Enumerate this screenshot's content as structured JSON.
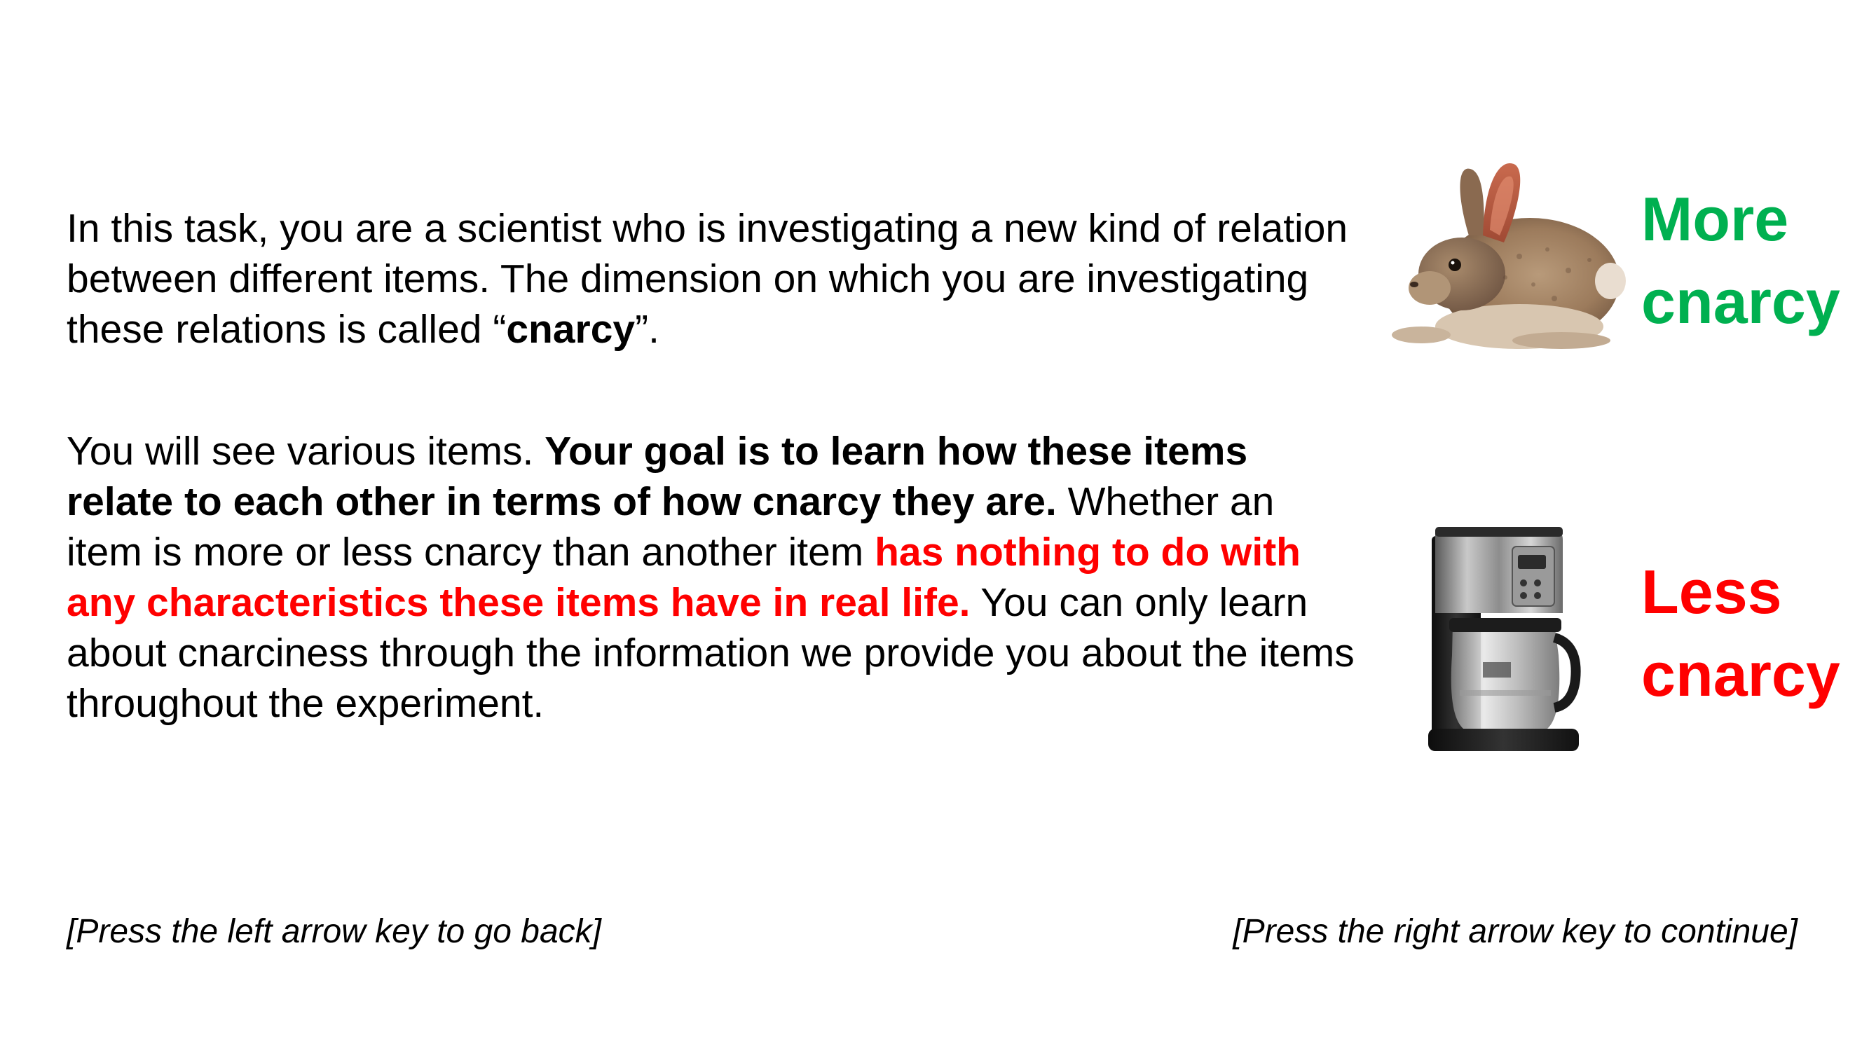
{
  "intro": {
    "p1_a": "In this task, you are a scientist who is investigating a new kind of relation between different items. The dimension on which you are investigating these relations is called “",
    "p1_bold": "cnarcy",
    "p1_b": "”.",
    "p2_a": "You will see various items. ",
    "p2_bold": "Your goal is to learn how these items relate to each other in terms of how cnarcy they are.",
    "p2_b": " Whether an item is more or less cnarcy than another item ",
    "p2_red": "has nothing to do with any characteristics these items have in real life.",
    "p2_c": " You can only learn about cnarciness through the information we provide you about the items throughout the experiment."
  },
  "legend": {
    "more": {
      "line1": "More",
      "line2": "cnarcy",
      "color": "#00b050",
      "image_icon": "rabbit-icon"
    },
    "less": {
      "line1": "Less",
      "line2": "cnarcy",
      "color": "#ff0000",
      "image_icon": "coffee-maker-icon"
    }
  },
  "nav": {
    "back": "[Press the left arrow key to go back]",
    "next": "[Press the right arrow key to continue]"
  },
  "colors": {
    "emphasis_red": "#ff0000",
    "more_green": "#00b050",
    "text": "#000000",
    "background": "#ffffff"
  }
}
